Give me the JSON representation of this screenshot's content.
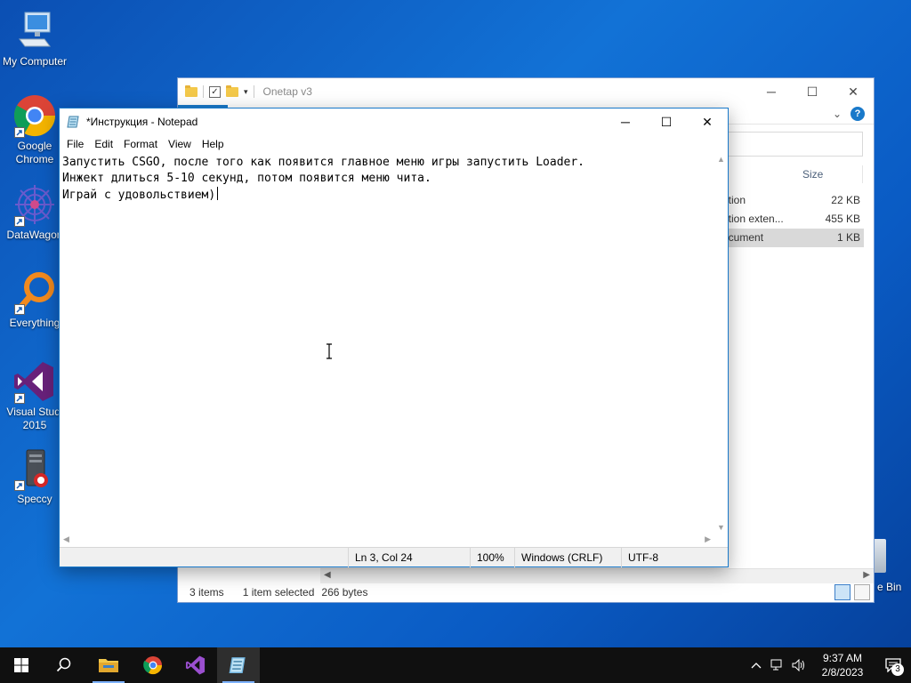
{
  "desktop": {
    "icons": [
      {
        "label": "My Computer"
      },
      {
        "label": "Google\nChrome"
      },
      {
        "label": "DataWagon"
      },
      {
        "label": "Everything"
      },
      {
        "label": "Visual Studi\n2015"
      },
      {
        "label": "Speccy"
      }
    ],
    "recycle_bin_label": "e Bin"
  },
  "explorer": {
    "title": "Onetap v3",
    "column_size": "Size",
    "files": [
      {
        "name": "ation",
        "size": "22 KB",
        "selected": false
      },
      {
        "name": "ation exten...",
        "size": "455 KB",
        "selected": false
      },
      {
        "name": "ocument",
        "size": "1 KB",
        "selected": true
      }
    ],
    "status": {
      "items": "3 items",
      "selected": "1 item selected",
      "bytes": "266 bytes"
    }
  },
  "notepad": {
    "title": "*Инструкция - Notepad",
    "menu": [
      "File",
      "Edit",
      "Format",
      "View",
      "Help"
    ],
    "lines": [
      "Запустить CSGO, после того как появится главное меню игры запустить Loader.",
      "Инжект длиться 5-10 секунд, потом появится меню чита.",
      "Играй с удовольствием)"
    ],
    "status": {
      "position": "Ln 3, Col 24",
      "zoom": "100%",
      "line_ending": "Windows (CRLF)",
      "encoding": "UTF-8"
    }
  },
  "taskbar": {
    "time": "9:37 AM",
    "date": "2/8/2023",
    "notification_count": "3"
  },
  "colors": {
    "accent": "#1979ca",
    "taskbar": "#101010"
  }
}
